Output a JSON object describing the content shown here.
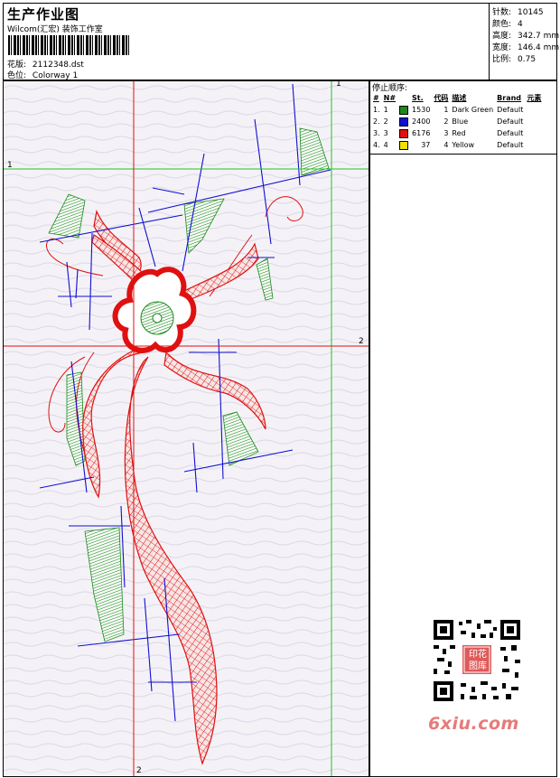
{
  "header": {
    "title": "生产作业图",
    "company": "Wilcom(汇宏) 装饰工作室",
    "design_label": "花版:",
    "design_value": "2112348.dst",
    "color_label": "色位:",
    "color_value": "Colorway 1"
  },
  "stats": [
    {
      "key": "针数:",
      "value": "10145"
    },
    {
      "key": "颜色:",
      "value": "4"
    },
    {
      "key": "高度:",
      "value": "342.7 mm"
    },
    {
      "key": "宽度:",
      "value": "146.4 mm"
    },
    {
      "key": "比例:",
      "value": "0.75"
    }
  ],
  "stop_sequence": {
    "title": "停止顺序:",
    "columns": [
      "#",
      "N#",
      "St.",
      "代码",
      "描述",
      "Brand",
      "元素"
    ],
    "rows": [
      {
        "num": "1.",
        "needle": "1",
        "color": "#1a8a1a",
        "stitches": "1530",
        "code": "1",
        "desc": "Dark Green",
        "brand": "Default",
        "element": ""
      },
      {
        "num": "2.",
        "needle": "2",
        "color": "#1010d0",
        "stitches": "2400",
        "code": "2",
        "desc": "Blue",
        "brand": "Default",
        "element": ""
      },
      {
        "num": "3.",
        "needle": "3",
        "color": "#e01010",
        "stitches": "6176",
        "code": "3",
        "desc": "Red",
        "brand": "Default",
        "element": ""
      },
      {
        "num": "4.",
        "needle": "4",
        "color": "#f0e000",
        "stitches": "37",
        "code": "4",
        "desc": "Yellow",
        "brand": "Default",
        "element": ""
      }
    ]
  },
  "guides": {
    "label_1": "1",
    "label_2": "2",
    "guide_colors": {
      "green": "#22c422",
      "red": "#e01010"
    }
  },
  "watermark": {
    "brand_text": "6xiu.com",
    "qr_seal_text": "印花图库",
    "qr_icon": "qr-code-icon"
  }
}
